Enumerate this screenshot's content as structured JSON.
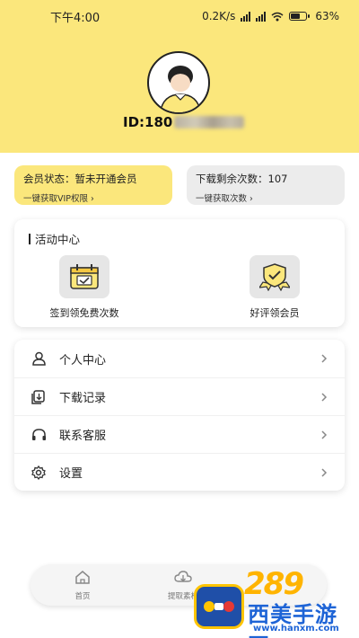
{
  "status_bar": {
    "time": "下午4:00",
    "speed": "0.2K/s",
    "battery": "63%"
  },
  "profile": {
    "id_prefix": "ID:180"
  },
  "vip_card": {
    "title": "会员状态：暂未开通会员",
    "action": "一键获取VIP权限 ›"
  },
  "download_card": {
    "title": "下载剩余次数：107",
    "action": "一键获取次数 ›"
  },
  "activity": {
    "title": "活动中心",
    "items": [
      {
        "label": "签到领免费次数",
        "icon": "calendar-check-icon"
      },
      {
        "label": "好评领会员",
        "icon": "badge-check-icon"
      }
    ]
  },
  "menu": {
    "items": [
      {
        "label": "个人中心",
        "icon": "user-icon"
      },
      {
        "label": "下载记录",
        "icon": "download-record-icon"
      },
      {
        "label": "联系客服",
        "icon": "headset-icon"
      },
      {
        "label": "设置",
        "icon": "gear-icon"
      }
    ]
  },
  "tabbar": {
    "tabs": [
      {
        "label": "首页",
        "icon": "home-icon"
      },
      {
        "label": "提取素材",
        "icon": "cloud-download-icon"
      }
    ]
  },
  "watermark": {
    "logo": "289",
    "site_name": "西美手游网",
    "url": "www.hanxm.com"
  },
  "colors": {
    "accent_yellow": "#fbe77c",
    "card_gray": "#ececec",
    "watermark_blue": "#1e64d6",
    "watermark_orange": "#ffb400"
  }
}
